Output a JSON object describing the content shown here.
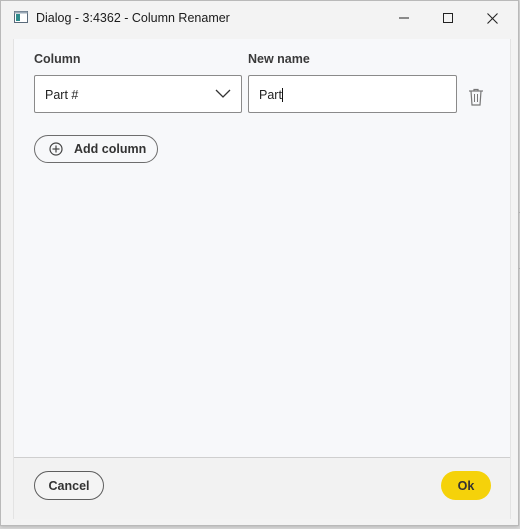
{
  "window": {
    "title": "Dialog - 3:4362 - Column Renamer",
    "controls": [
      "minimize-icon",
      "maximize-icon",
      "close-icon"
    ]
  },
  "form": {
    "column_label": "Column",
    "new_name_label": "New name",
    "rows": [
      {
        "column_value": "Part #",
        "new_name_value": "Part"
      }
    ],
    "add_column_label": "Add column"
  },
  "footer": {
    "cancel_label": "Cancel",
    "ok_label": "Ok"
  },
  "colors": {
    "accent": "#f5d20a",
    "border": "#8a8a8a",
    "text": "#333333"
  }
}
